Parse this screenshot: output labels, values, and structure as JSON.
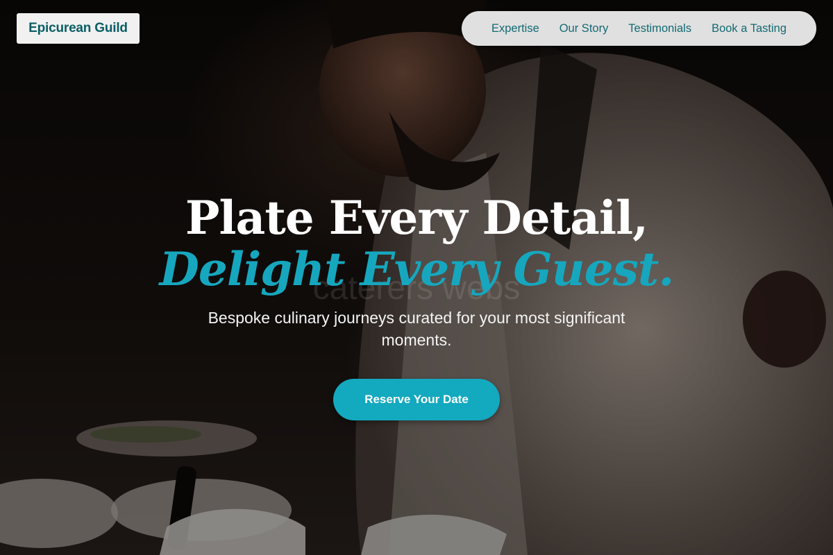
{
  "brand": {
    "name": "Epicurean Guild",
    "accent_color": "#13a9bf",
    "brand_text_color": "#0b5e64"
  },
  "nav": {
    "items": [
      {
        "label": "Expertise"
      },
      {
        "label": "Our Story"
      },
      {
        "label": "Testimonials"
      },
      {
        "label": "Book a Tasting"
      }
    ]
  },
  "hero": {
    "title_line1": "Plate Every Detail,",
    "title_line2": "Delight Every Guest.",
    "watermark": "caterers webs",
    "subtitle": "Bespoke culinary journeys curated for your most significant moments.",
    "cta_label": "Reserve Your Date",
    "image_subject": "chef plating dishes in dim kitchen"
  }
}
